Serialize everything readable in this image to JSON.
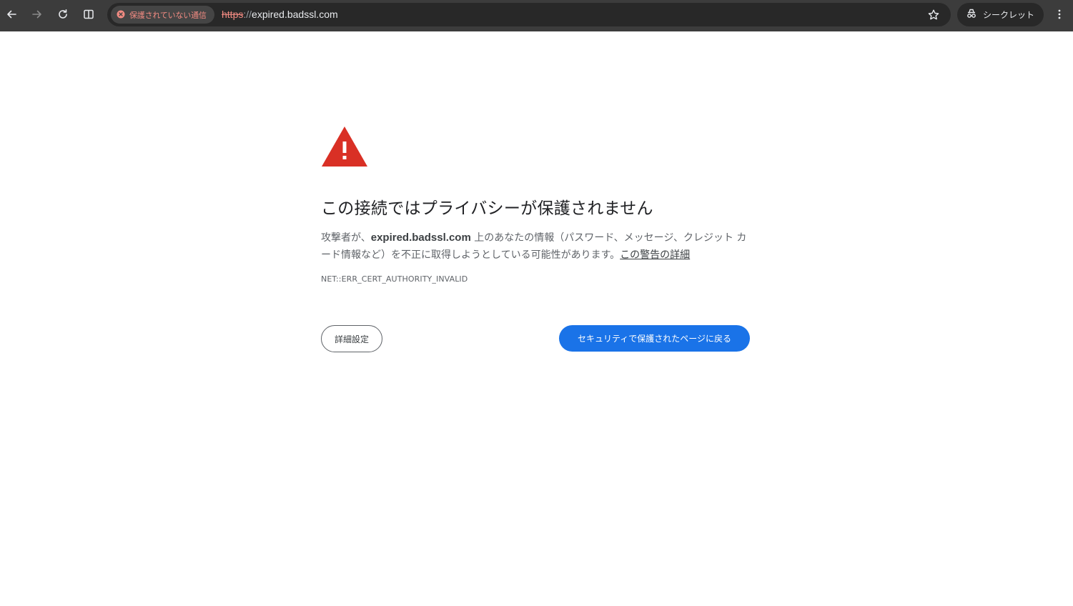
{
  "toolbar": {
    "icons": {
      "back": "arrow-left-icon",
      "forward": "arrow-right-icon",
      "reload": "reload-icon",
      "split": "split-view-icon",
      "security": "not-secure-icon",
      "star": "star-icon",
      "incognito": "incognito-icon",
      "menu": "kebab-menu-icon"
    },
    "security_chip_label": "保護されていない通信",
    "url": {
      "scheme": "https",
      "separator": "://",
      "host": "expired.badssl.com"
    },
    "incognito_label": "シークレット"
  },
  "interstitial": {
    "icon": "warning-triangle-icon",
    "heading": "この接続ではプライバシーが保護されません",
    "description": {
      "prefix": "攻撃者が、",
      "host": "expired.badssl.com",
      "suffix": " 上のあなたの情報（パスワード、メッセージ、クレジット カード情報など）を不正に取得しようとしている可能性があります。",
      "link": "この警告の詳細"
    },
    "error_code": "NET::ERR_CERT_AUTHORITY_INVALID",
    "advanced_button": "詳細設定",
    "back_button": "セキュリティで保護されたページに戻る"
  },
  "colors": {
    "toolbar_bg": "#3c3c3c",
    "omnibox_bg": "#282828",
    "not_secure": "#f28b82",
    "warning_red": "#d93025",
    "primary_blue": "#1a73e8",
    "heading_text": "#202124",
    "body_text": "#5f6368"
  }
}
